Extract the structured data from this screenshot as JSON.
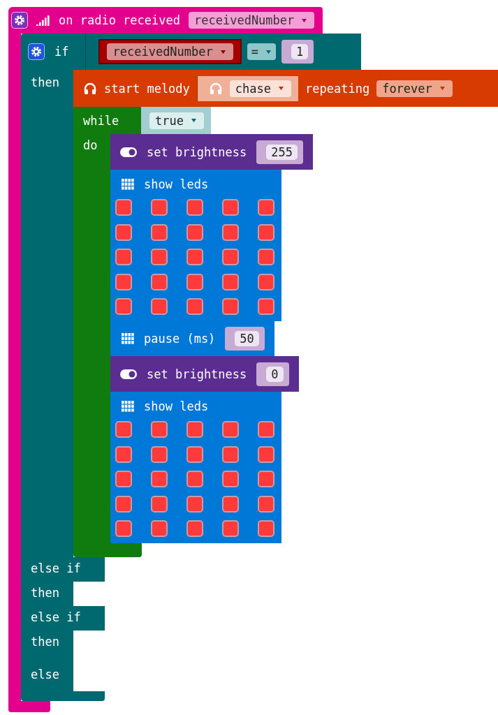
{
  "event": {
    "label": "on radio received",
    "variable": "receivedNumber"
  },
  "if_block": {
    "label": "if",
    "condition": {
      "variable": "receivedNumber",
      "operator": "=",
      "value": "1"
    },
    "then_label": "then",
    "body": [
      {
        "kind": "melody",
        "label": "start melody",
        "melody": "chase",
        "repeat_label": "repeating",
        "repeat": "forever"
      },
      {
        "kind": "while",
        "label": "while",
        "condition": "true",
        "do_label": "do",
        "body": [
          {
            "kind": "brightness",
            "label": "set brightness",
            "value": "255"
          },
          {
            "kind": "show_leds",
            "label": "show leds",
            "leds": [
              [
                true,
                true,
                true,
                true,
                true
              ],
              [
                true,
                true,
                true,
                true,
                true
              ],
              [
                true,
                true,
                true,
                true,
                true
              ],
              [
                true,
                true,
                true,
                true,
                true
              ],
              [
                true,
                true,
                true,
                true,
                true
              ]
            ]
          },
          {
            "kind": "pause",
            "label": "pause (ms)",
            "value": "50"
          },
          {
            "kind": "brightness",
            "label": "set brightness",
            "value": "0"
          },
          {
            "kind": "show_leds",
            "label": "show leds",
            "leds": [
              [
                true,
                true,
                true,
                true,
                true
              ],
              [
                true,
                true,
                true,
                true,
                true
              ],
              [
                true,
                true,
                true,
                true,
                true
              ],
              [
                true,
                true,
                true,
                true,
                true
              ],
              [
                true,
                true,
                true,
                true,
                true
              ]
            ]
          }
        ]
      }
    ],
    "clauses": [
      {
        "kind": "else_if",
        "label": "else if"
      },
      {
        "kind": "then",
        "label": "then"
      },
      {
        "kind": "else_if",
        "label": "else if"
      },
      {
        "kind": "then",
        "label": "then"
      },
      {
        "kind": "else",
        "label": "else"
      }
    ]
  }
}
